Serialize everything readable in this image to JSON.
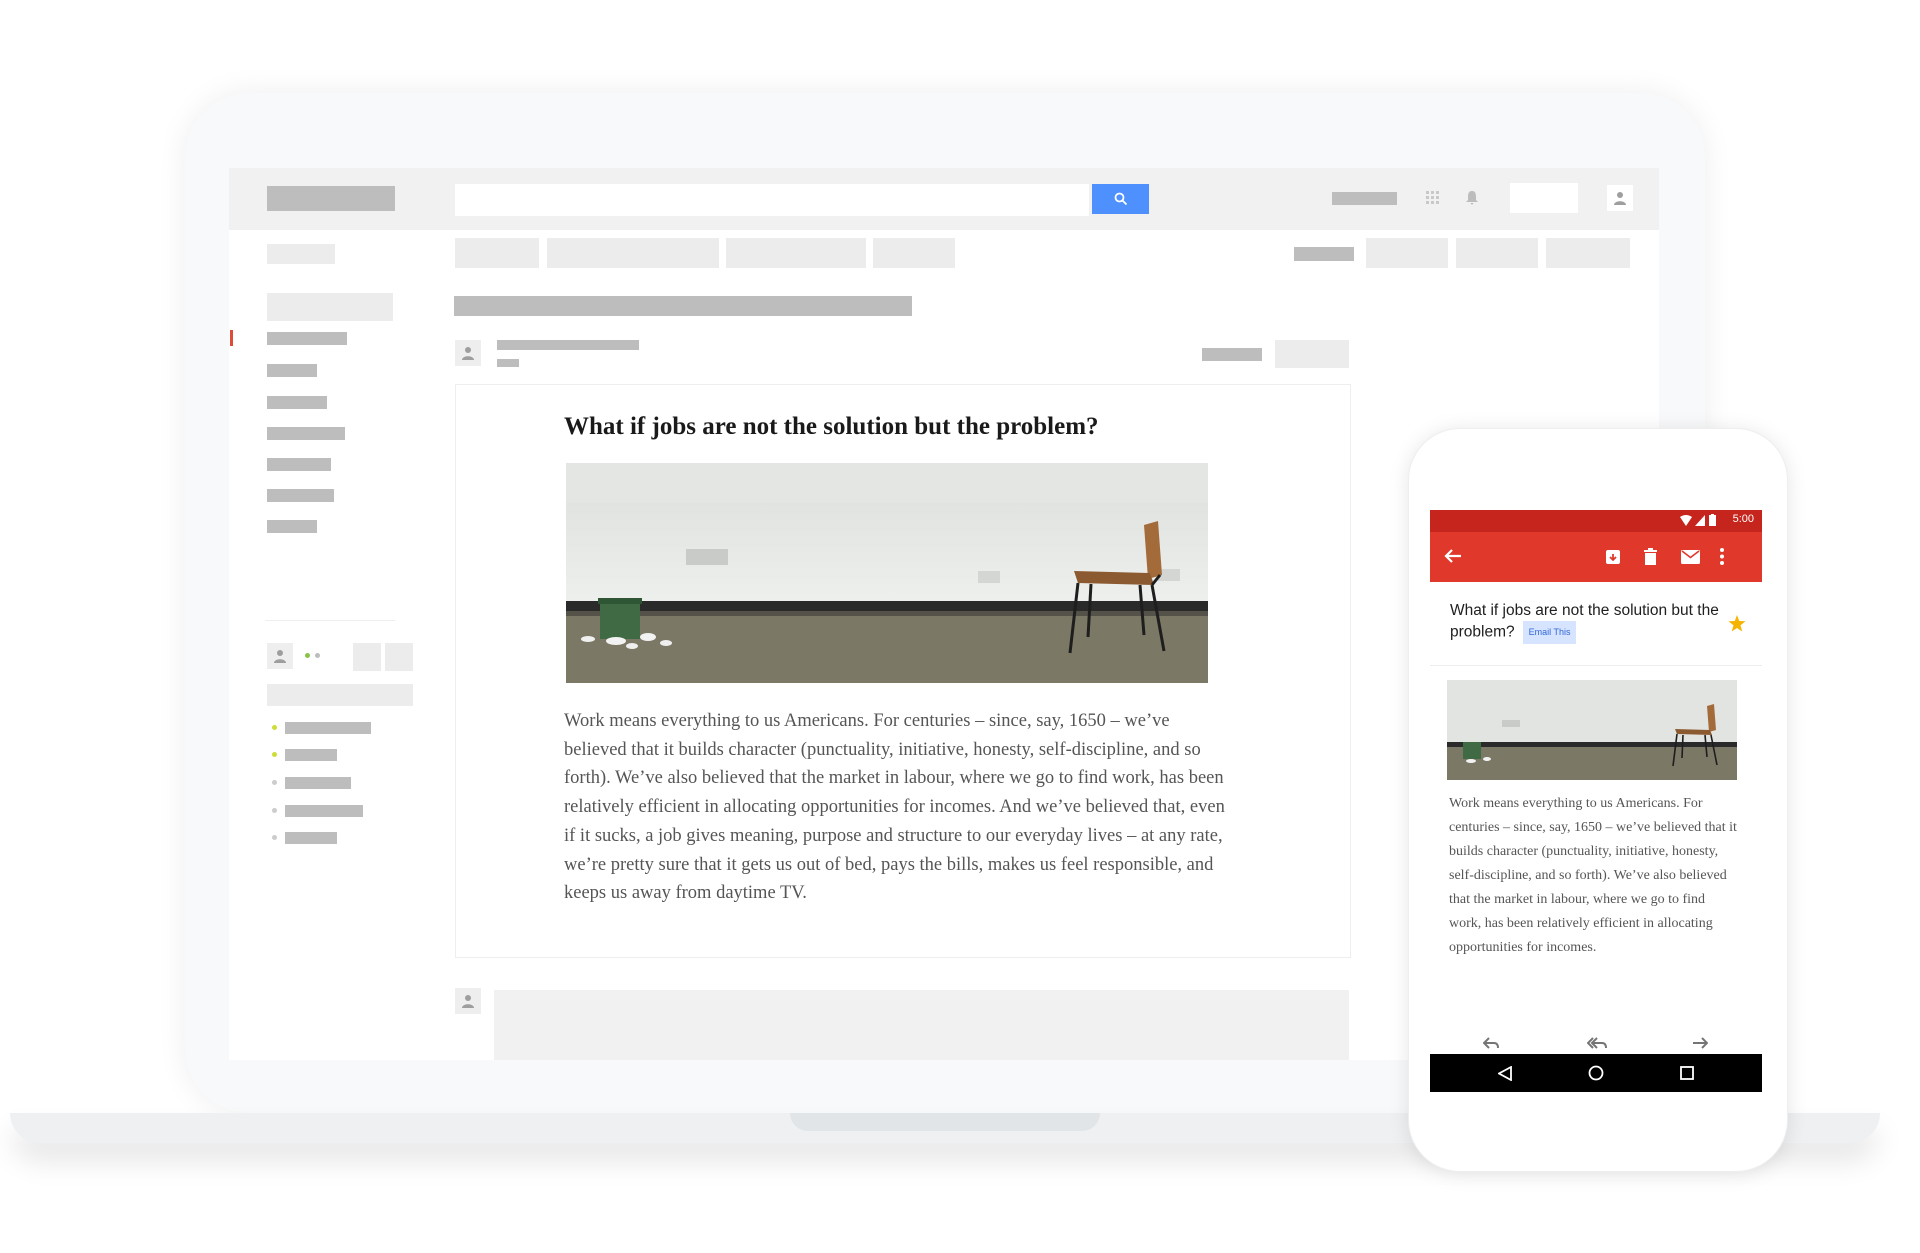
{
  "message": {
    "title": "What if jobs are not the solution but the problem?",
    "body": "Work means everything to us Americans. For centuries – since, say, 1650 – we’ve believed that it builds character (punctuality, initiative, honesty, self-discipline, and so forth). We’ve also believed that the market in labour, where we go to find work, has been relatively efficient in allocating opportunities for incomes. And we’ve believed that, even if it sucks, a job gives meaning, purpose and structure to our everyday lives – at any rate, we’re pretty sure that it gets us out of bed, pays the bills, makes us feel responsible, and keeps us away from daytime TV."
  },
  "phone": {
    "status_time": "5:00",
    "subject": "What if jobs are not the solution but the problem?",
    "chip_label": "Email This",
    "body": "Work means everything to us Americans. For centuries – since, say, 1650 – we’ve believed that it builds character (punctuality, initiative, honesty, self-discipline, and so forth). We’ve also believed that the market in labour, where we go to find work, has been relatively efficient in allocating opportunities for incomes."
  },
  "icons": {
    "search": "search-icon",
    "apps": "apps-grid-icon",
    "notifications": "bell-icon",
    "account": "person-icon",
    "back": "arrow-back-icon",
    "archive": "archive-icon",
    "delete": "trash-icon",
    "mark_unread": "mail-icon",
    "more": "more-vert-icon",
    "star": "star-icon",
    "reply": "reply-icon",
    "reply_all": "reply-all-icon",
    "forward": "forward-icon"
  },
  "colors": {
    "search_button": "#4d90fe",
    "phone_appbar": "#e0382b",
    "phone_statusbar": "#c5251d",
    "star": "#f4b400",
    "active_indicator": "#dd4b39"
  }
}
